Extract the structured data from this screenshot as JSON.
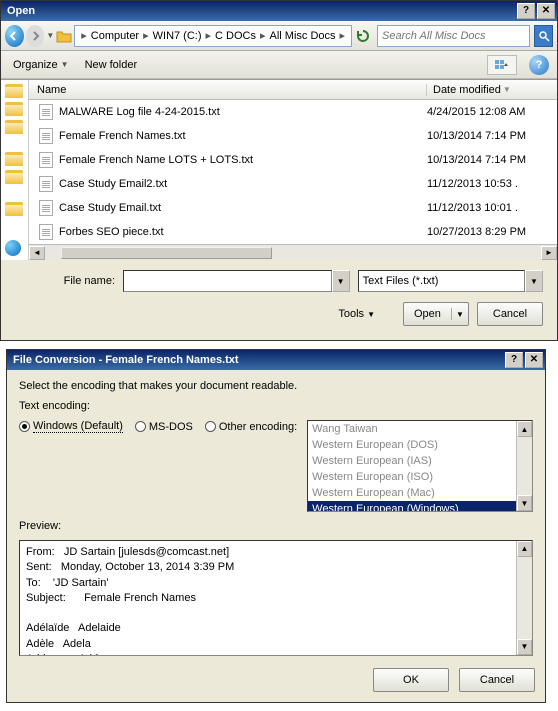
{
  "open": {
    "title": "Open",
    "breadcrumb": [
      "Computer",
      "WIN7 (C:)",
      "C DOCs",
      "All Misc Docs"
    ],
    "search_placeholder": "Search All Misc Docs",
    "organize": "Organize",
    "new_folder": "New folder",
    "col_name": "Name",
    "col_date": "Date modified",
    "files": [
      {
        "name": "MALWARE Log file 4-24-2015.txt",
        "date": "4/24/2015 12:08 AM"
      },
      {
        "name": "Female French Names.txt",
        "date": "10/13/2014 7:14 PM"
      },
      {
        "name": "Female French Name LOTS + LOTS.txt",
        "date": "10/13/2014 7:14 PM"
      },
      {
        "name": "Case Study Email2.txt",
        "date": "11/12/2013 10:53 ."
      },
      {
        "name": "Case Study Email.txt",
        "date": "11/12/2013 10:01 ."
      },
      {
        "name": "Forbes SEO piece.txt",
        "date": "10/27/2013 8:29 PM"
      }
    ],
    "filename_label": "File name:",
    "filename_value": "",
    "filetype": "Text Files (*.txt)",
    "tools": "Tools",
    "open_btn": "Open",
    "cancel": "Cancel"
  },
  "conv": {
    "title": "File Conversion - Female French Names.txt",
    "instruction": "Select the encoding that makes your document readable.",
    "text_encoding": "Text encoding:",
    "radio_windows": "Windows (Default)",
    "radio_msdos": "MS-DOS",
    "radio_other": "Other encoding:",
    "enc_options": [
      "Wang Taiwan",
      "Western European (DOS)",
      "Western European (IAS)",
      "Western European (ISO)",
      "Western European (Mac)",
      "Western European (Windows)"
    ],
    "enc_selected_index": 5,
    "preview_label": "Preview:",
    "preview_text": "From:   JD Sartain [julesds@comcast.net]\nSent:   Monday, October 13, 2014 3:39 PM\nTo:    'JD Sartain'\nSubject:      Female French Names\n\nAdélaïde   Adelaide\nAdèle   Adela\nAdrienne   Adriana",
    "ok": "OK",
    "cancel": "Cancel"
  }
}
